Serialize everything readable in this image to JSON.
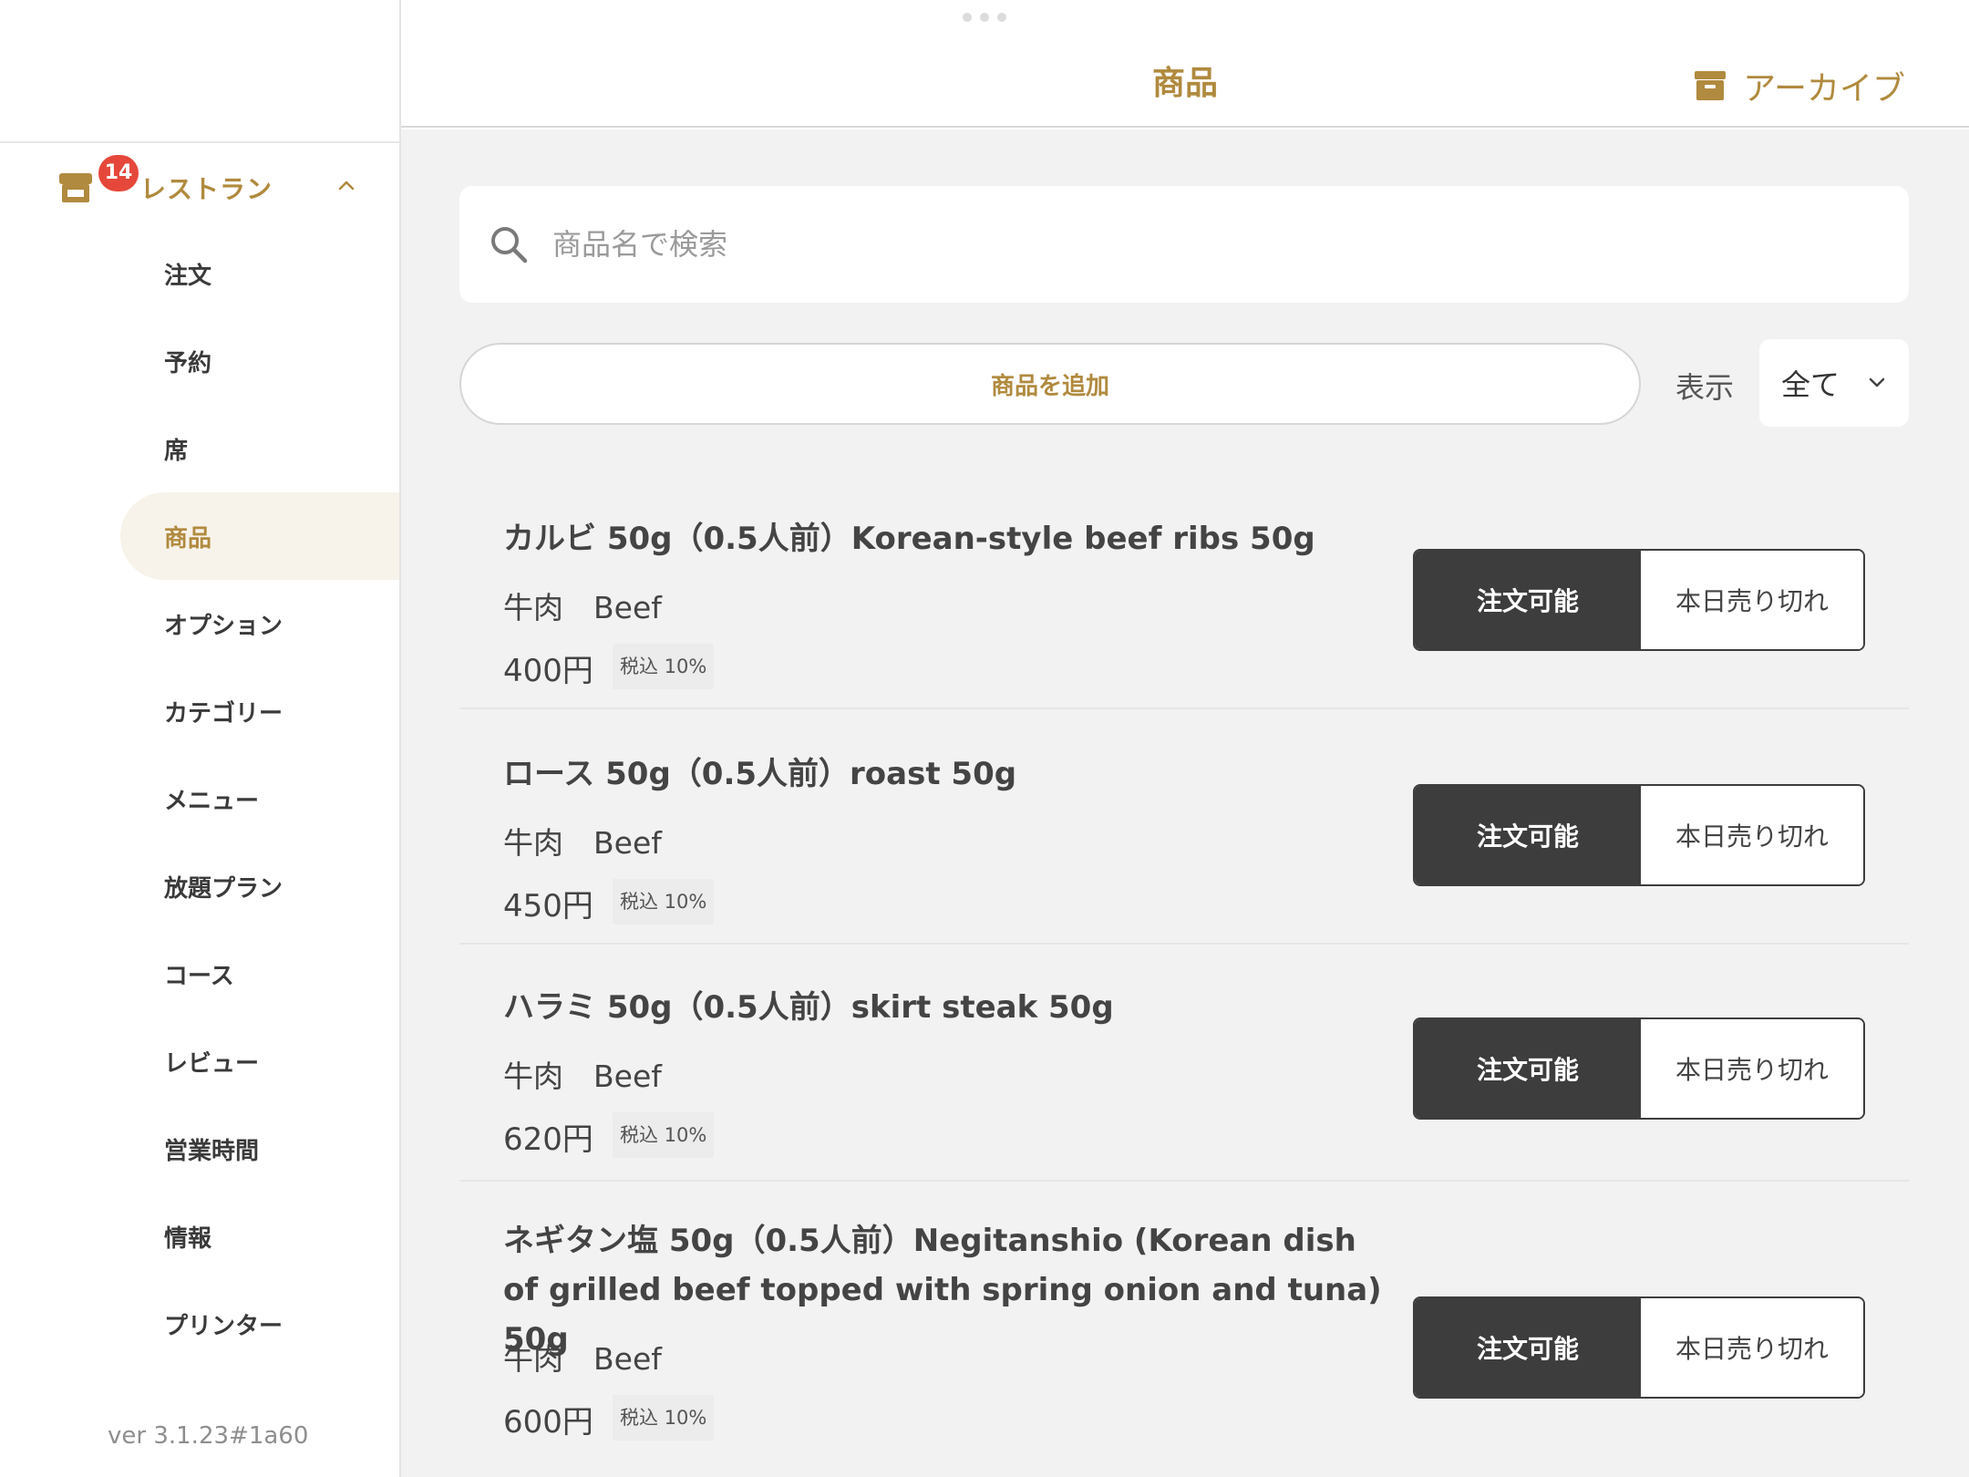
{
  "header": {
    "title": "商品",
    "archive_label": "アーカイブ"
  },
  "sidebar": {
    "group": {
      "label": "レストラン",
      "badge": "14"
    },
    "items": [
      {
        "label": "注文"
      },
      {
        "label": "予約"
      },
      {
        "label": "席"
      },
      {
        "label": "商品"
      },
      {
        "label": "オプション"
      },
      {
        "label": "カテゴリー"
      },
      {
        "label": "メニュー"
      },
      {
        "label": "放題プラン"
      },
      {
        "label": "コース"
      },
      {
        "label": "レビュー"
      },
      {
        "label": "営業時間"
      },
      {
        "label": "情報"
      },
      {
        "label": "プリンター"
      }
    ],
    "active_item": "商品",
    "version": "ver 3.1.23#1a60"
  },
  "search": {
    "placeholder": "商品名で検索",
    "value": ""
  },
  "toolbar": {
    "add_label": "商品を追加",
    "filter_label": "表示",
    "filter_value": "全て"
  },
  "products": [
    {
      "name": "カルビ 50g（0.5人前）Korean-style beef ribs 50g",
      "category": "牛肉　Beef",
      "price": "400円",
      "tax": "税込 10%",
      "available_label": "注文可能",
      "soldout_label": "本日売り切れ"
    },
    {
      "name": "ロース 50g（0.5人前）roast 50g",
      "category": "牛肉　Beef",
      "price": "450円",
      "tax": "税込 10%",
      "available_label": "注文可能",
      "soldout_label": "本日売り切れ"
    },
    {
      "name": "ハラミ 50g（0.5人前）skirt steak 50g",
      "category": "牛肉　Beef",
      "price": "620円",
      "tax": "税込 10%",
      "available_label": "注文可能",
      "soldout_label": "本日売り切れ"
    },
    {
      "name": "ネギタン塩 50g（0.5人前）Negitanshio (Korean dish of grilled beef topped with spring onion and tuna) 50g",
      "category": "牛肉　Beef",
      "price": "600円",
      "tax": "税込 10%",
      "available_label": "注文可能",
      "soldout_label": "本日売り切れ"
    }
  ],
  "colors": {
    "accent": "#b08a3e",
    "badge": "#e5483a",
    "segment_dark": "#3d3d3d",
    "background": "#f2f2f2"
  }
}
